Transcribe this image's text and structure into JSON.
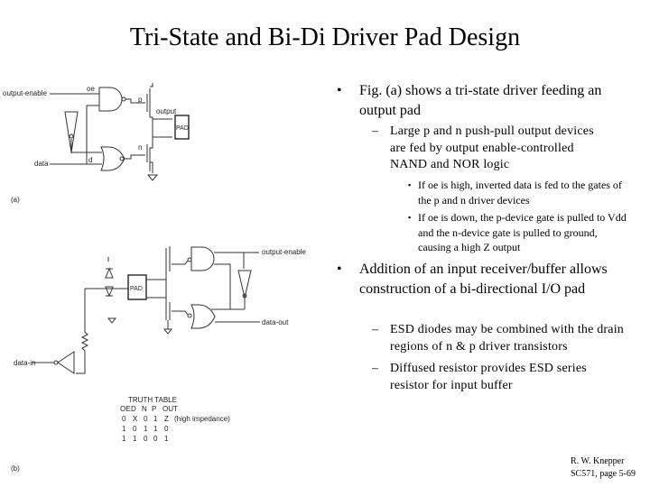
{
  "title": "Tri-State and Bi-Di Driver Pad Design",
  "bullets": [
    {
      "text": "Fig. (a) shows a tri-state driver feeding an output pad",
      "subs": [
        {
          "text": "Large p and n push-pull output devices are fed by output enable-controlled NAND and NOR logic",
          "subs": [
            "If oe is high, inverted data is fed to the gates of the p and n driver devices",
            "If oe is down, the p-device gate is pulled to Vdd and the n-device gate is pulled to ground, causing a high Z output"
          ]
        }
      ]
    },
    {
      "text": "Addition of an input receiver/buffer allows construction of a bi-directional I/O pad",
      "subs": [
        {
          "text": "ESD diodes may be combined with the drain regions of n & p driver transistors"
        },
        {
          "text": "Diffused resistor provides ESD series resistor for input buffer"
        }
      ]
    }
  ],
  "fig_a": {
    "label": "(a)",
    "output_enable": "output-enable",
    "data": "data",
    "oe": "oe",
    "d": "d",
    "p": "p",
    "n": "n",
    "output": "output",
    "pad": "PAD"
  },
  "fig_b": {
    "label": "(b)",
    "output_enable": "output-enable",
    "data_out": "data-out",
    "data_in": "data-in",
    "pad": "PAD",
    "truth_table": {
      "title": "TRUTH TABLE",
      "headers": [
        "OE",
        "D",
        "N",
        "P",
        "OUT"
      ],
      "rows": [
        [
          "0",
          "X",
          "0",
          "1",
          "Z"
        ],
        [
          "1",
          "0",
          "1",
          "1",
          "0"
        ],
        [
          "1",
          "1",
          "0",
          "0",
          "1"
        ]
      ],
      "note": "(high impedance)"
    }
  },
  "footer": {
    "author": "R. W. Knepper",
    "page": "SC571, page 5-69"
  }
}
